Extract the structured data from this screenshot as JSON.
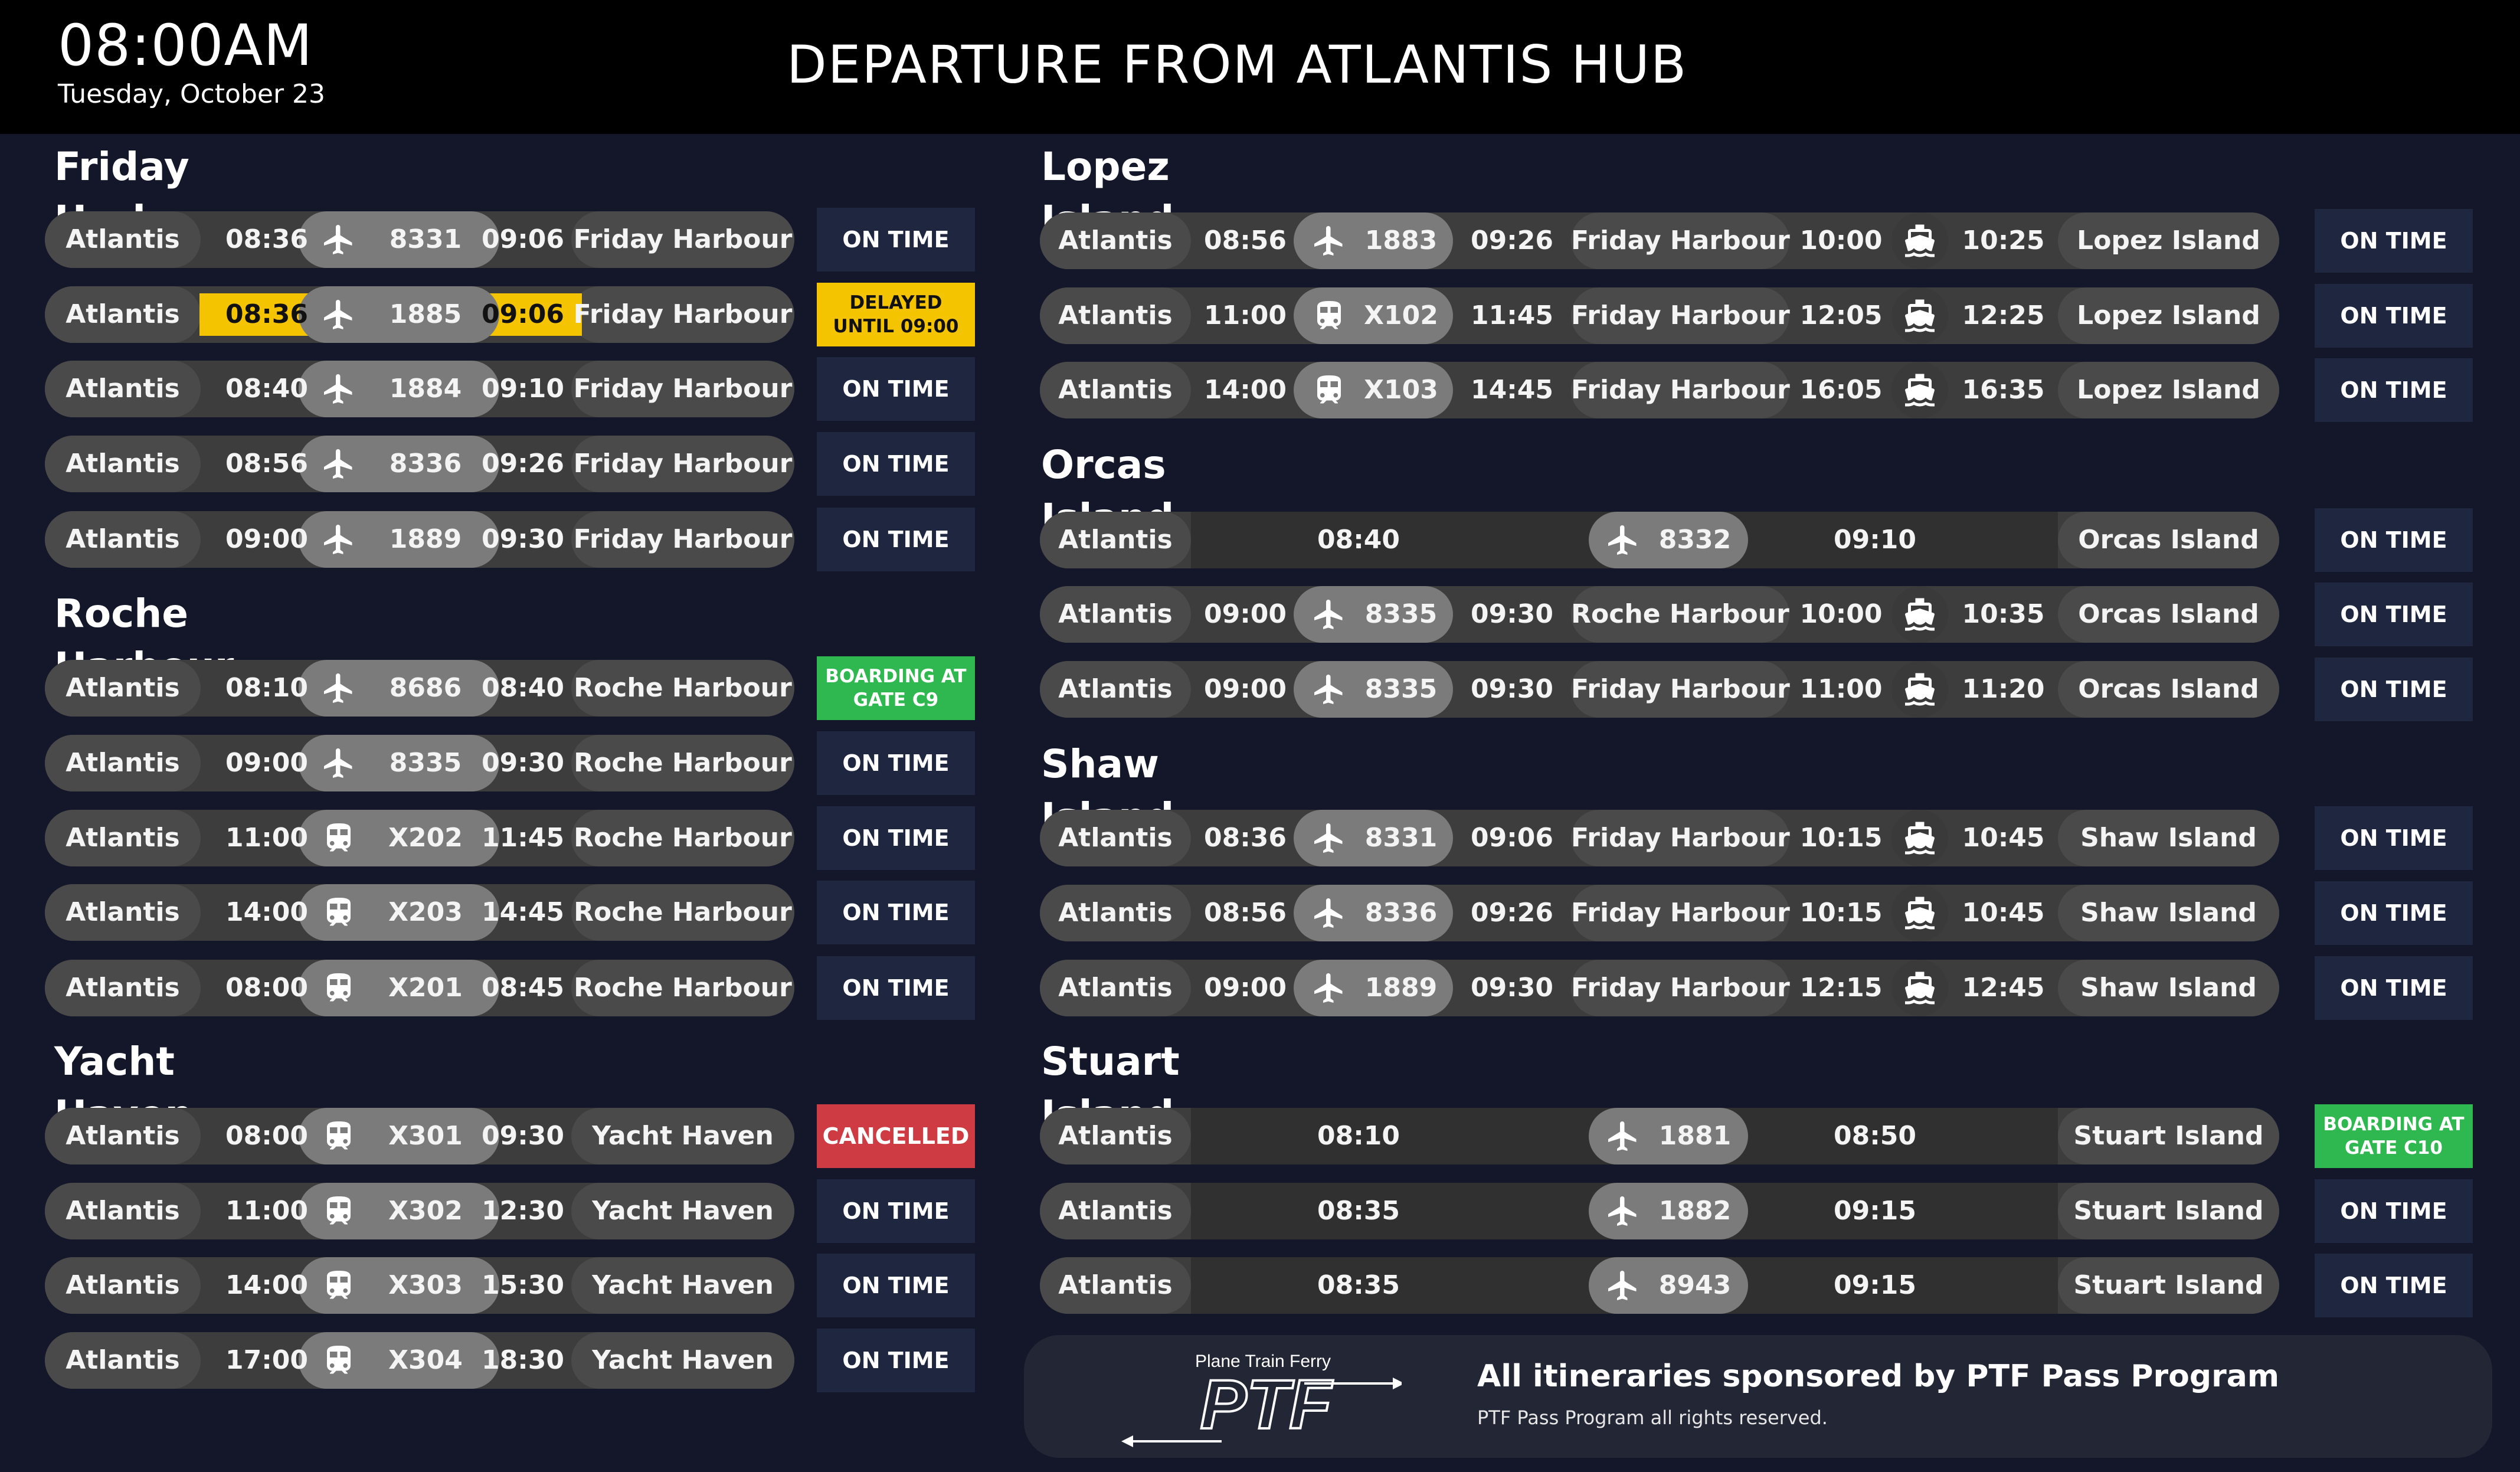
{
  "header": {
    "time": "08:00AM",
    "date": "Tuesday, October 23",
    "title": "DEPARTURE FROM ATLANTIS HUB"
  },
  "colors": {
    "background": "#141729",
    "on_time": "#1e2640",
    "delayed": "#f5c400",
    "boarding": "#2fb84f",
    "cancelled": "#cf3b43"
  },
  "left_sections": [
    {
      "title": "Friday Harbour",
      "rows": [
        {
          "origin": "Atlantis",
          "dep": "08:36",
          "mode": "plane",
          "number": "8331",
          "arr": "09:06",
          "dest": "Friday Harbour",
          "status": "ON TIME",
          "kind": "ontime"
        },
        {
          "origin": "Atlantis",
          "dep": "08:36",
          "mode": "plane",
          "number": "1885",
          "arr": "09:06",
          "dest": "Friday Harbour",
          "status": "DELAYED\nUNTIL 09:00",
          "kind": "delayed",
          "highlight": true
        },
        {
          "origin": "Atlantis",
          "dep": "08:40",
          "mode": "plane",
          "number": "1884",
          "arr": "09:10",
          "dest": "Friday Harbour",
          "status": "ON TIME",
          "kind": "ontime"
        },
        {
          "origin": "Atlantis",
          "dep": "08:56",
          "mode": "plane",
          "number": "8336",
          "arr": "09:26",
          "dest": "Friday Harbour",
          "status": "ON TIME",
          "kind": "ontime"
        },
        {
          "origin": "Atlantis",
          "dep": "09:00",
          "mode": "plane",
          "number": "1889",
          "arr": "09:30",
          "dest": "Friday Harbour",
          "status": "ON TIME",
          "kind": "ontime"
        }
      ]
    },
    {
      "title": "Roche Harbour",
      "rows": [
        {
          "origin": "Atlantis",
          "dep": "08:10",
          "mode": "plane",
          "number": "8686",
          "arr": "08:40",
          "dest": "Roche Harbour",
          "status": "BOARDING AT\nGATE C9",
          "kind": "boarding"
        },
        {
          "origin": "Atlantis",
          "dep": "09:00",
          "mode": "plane",
          "number": "8335",
          "arr": "09:30",
          "dest": "Roche Harbour",
          "status": "ON TIME",
          "kind": "ontime"
        },
        {
          "origin": "Atlantis",
          "dep": "11:00",
          "mode": "train",
          "number": "X202",
          "arr": "11:45",
          "dest": "Roche Harbour",
          "status": "ON TIME",
          "kind": "ontime"
        },
        {
          "origin": "Atlantis",
          "dep": "14:00",
          "mode": "train",
          "number": "X203",
          "arr": "14:45",
          "dest": "Roche Harbour",
          "status": "ON TIME",
          "kind": "ontime"
        },
        {
          "origin": "Atlantis",
          "dep": "08:00",
          "mode": "train",
          "number": "X201",
          "arr": "08:45",
          "dest": "Roche Harbour",
          "status": "ON TIME",
          "kind": "ontime"
        }
      ]
    },
    {
      "title": "Yacht Haven",
      "rows": [
        {
          "origin": "Atlantis",
          "dep": "08:00",
          "mode": "train",
          "number": "X301",
          "arr": "09:30",
          "dest": "Yacht Haven",
          "status": "CANCELLED",
          "kind": "cancelled"
        },
        {
          "origin": "Atlantis",
          "dep": "11:00",
          "mode": "train",
          "number": "X302",
          "arr": "12:30",
          "dest": "Yacht Haven",
          "status": "ON TIME",
          "kind": "ontime"
        },
        {
          "origin": "Atlantis",
          "dep": "14:00",
          "mode": "train",
          "number": "X303",
          "arr": "15:30",
          "dest": "Yacht Haven",
          "status": "ON TIME",
          "kind": "ontime"
        },
        {
          "origin": "Atlantis",
          "dep": "17:00",
          "mode": "train",
          "number": "X304",
          "arr": "18:30",
          "dest": "Yacht Haven",
          "status": "ON TIME",
          "kind": "ontime"
        }
      ]
    }
  ],
  "right_sections": [
    {
      "title": "Lopez Island",
      "rows": [
        {
          "type": "connection",
          "origin": "Atlantis",
          "dep": "08:56",
          "mode": "plane",
          "number": "1883",
          "arr": "09:26",
          "via": "Friday Harbour",
          "ferry_dep": "10:00",
          "ferry_arr": "10:25",
          "dest": "Lopez Island",
          "status": "ON TIME",
          "kind": "ontime"
        },
        {
          "type": "connection",
          "origin": "Atlantis",
          "dep": "11:00",
          "mode": "train",
          "number": "X102",
          "arr": "11:45",
          "via": "Friday Harbour",
          "ferry_dep": "12:05",
          "ferry_arr": "12:25",
          "dest": "Lopez Island",
          "status": "ON TIME",
          "kind": "ontime"
        },
        {
          "type": "connection",
          "origin": "Atlantis",
          "dep": "14:00",
          "mode": "train",
          "number": "X103",
          "arr": "14:45",
          "via": "Friday Harbour",
          "ferry_dep": "16:05",
          "ferry_arr": "16:35",
          "dest": "Lopez Island",
          "status": "ON TIME",
          "kind": "ontime"
        }
      ]
    },
    {
      "title": "Orcas Island",
      "rows": [
        {
          "type": "direct",
          "origin": "Atlantis",
          "dep": "08:40",
          "mode": "plane",
          "number": "8332",
          "arr": "09:10",
          "dest": "Orcas Island",
          "status": "ON TIME",
          "kind": "ontime"
        },
        {
          "type": "connection",
          "origin": "Atlantis",
          "dep": "09:00",
          "mode": "plane",
          "number": "8335",
          "arr": "09:30",
          "via": "Roche Harbour",
          "ferry_dep": "10:00",
          "ferry_arr": "10:35",
          "dest": "Orcas Island",
          "status": "ON TIME",
          "kind": "ontime"
        },
        {
          "type": "connection",
          "origin": "Atlantis",
          "dep": "09:00",
          "mode": "plane",
          "number": "8335",
          "arr": "09:30",
          "via": "Friday Harbour",
          "ferry_dep": "11:00",
          "ferry_arr": "11:20",
          "dest": "Orcas Island",
          "status": "ON TIME",
          "kind": "ontime"
        }
      ]
    },
    {
      "title": "Shaw Island",
      "rows": [
        {
          "type": "connection",
          "origin": "Atlantis",
          "dep": "08:36",
          "mode": "plane",
          "number": "8331",
          "arr": "09:06",
          "via": "Friday Harbour",
          "ferry_dep": "10:15",
          "ferry_arr": "10:45",
          "dest": "Shaw Island",
          "status": "ON TIME",
          "kind": "ontime"
        },
        {
          "type": "connection",
          "origin": "Atlantis",
          "dep": "08:56",
          "mode": "plane",
          "number": "8336",
          "arr": "09:26",
          "via": "Friday Harbour",
          "ferry_dep": "10:15",
          "ferry_arr": "10:45",
          "dest": "Shaw Island",
          "status": "ON TIME",
          "kind": "ontime"
        },
        {
          "type": "connection",
          "origin": "Atlantis",
          "dep": "09:00",
          "mode": "plane",
          "number": "1889",
          "arr": "09:30",
          "via": "Friday Harbour",
          "ferry_dep": "12:15",
          "ferry_arr": "12:45",
          "dest": "Shaw Island",
          "status": "ON TIME",
          "kind": "ontime"
        }
      ]
    },
    {
      "title": "Stuart Island",
      "rows": [
        {
          "type": "direct",
          "origin": "Atlantis",
          "dep": "08:10",
          "mode": "plane",
          "number": "1881",
          "arr": "08:50",
          "dest": "Stuart Island",
          "status": "BOARDING AT\nGATE C10",
          "kind": "boarding"
        },
        {
          "type": "direct",
          "origin": "Atlantis",
          "dep": "08:35",
          "mode": "plane",
          "number": "1882",
          "arr": "09:15",
          "dest": "Stuart Island",
          "status": "ON TIME",
          "kind": "ontime"
        },
        {
          "type": "direct",
          "origin": "Atlantis",
          "dep": "08:35",
          "mode": "plane",
          "number": "8943",
          "arr": "09:15",
          "dest": "Stuart Island",
          "status": "ON TIME",
          "kind": "ontime"
        }
      ]
    }
  ],
  "footer": {
    "logo_tagline": "Plane Train Ferry",
    "logo_text": "PTF",
    "sponsor": "All itineraries sponsored by PTF Pass Program",
    "rights": "PTF Pass Program all rights reserved."
  }
}
